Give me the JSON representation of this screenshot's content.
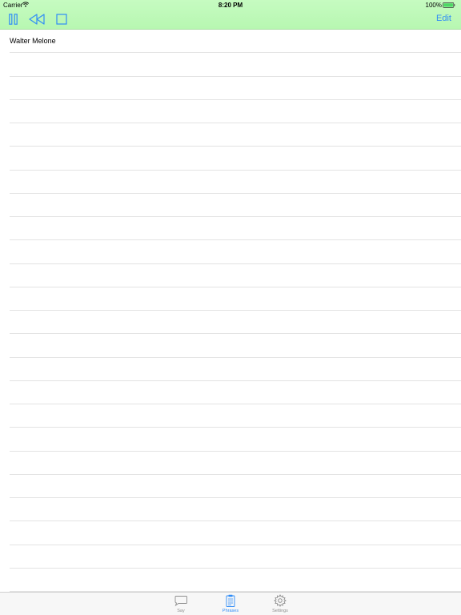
{
  "status_bar": {
    "carrier": "Carrier",
    "time": "8:20 PM",
    "battery_pct": "100%"
  },
  "toolbar": {
    "pause_icon": "pause-icon",
    "rewind_icon": "rewind-icon",
    "stop_icon": "stop-icon",
    "edit_label": "Edit"
  },
  "list": {
    "items": [
      {
        "label": "Walter Melone"
      },
      {
        "label": ""
      },
      {
        "label": ""
      },
      {
        "label": ""
      },
      {
        "label": ""
      },
      {
        "label": ""
      },
      {
        "label": ""
      },
      {
        "label": ""
      },
      {
        "label": ""
      },
      {
        "label": ""
      },
      {
        "label": ""
      },
      {
        "label": ""
      },
      {
        "label": ""
      },
      {
        "label": ""
      },
      {
        "label": ""
      },
      {
        "label": ""
      },
      {
        "label": ""
      },
      {
        "label": ""
      },
      {
        "label": ""
      },
      {
        "label": ""
      },
      {
        "label": ""
      },
      {
        "label": ""
      },
      {
        "label": ""
      },
      {
        "label": ""
      }
    ]
  },
  "tabbar": {
    "tabs": [
      {
        "label": "Say",
        "icon": "speech-bubble-icon"
      },
      {
        "label": "Phrases",
        "icon": "clipboard-icon",
        "active": true
      },
      {
        "label": "Settings",
        "icon": "gear-icon"
      }
    ]
  },
  "colors": {
    "accent": "#2f8cf7",
    "header_bg": "#c1fabb",
    "battery": "#4cd964",
    "separator": "#e3e3e3"
  }
}
